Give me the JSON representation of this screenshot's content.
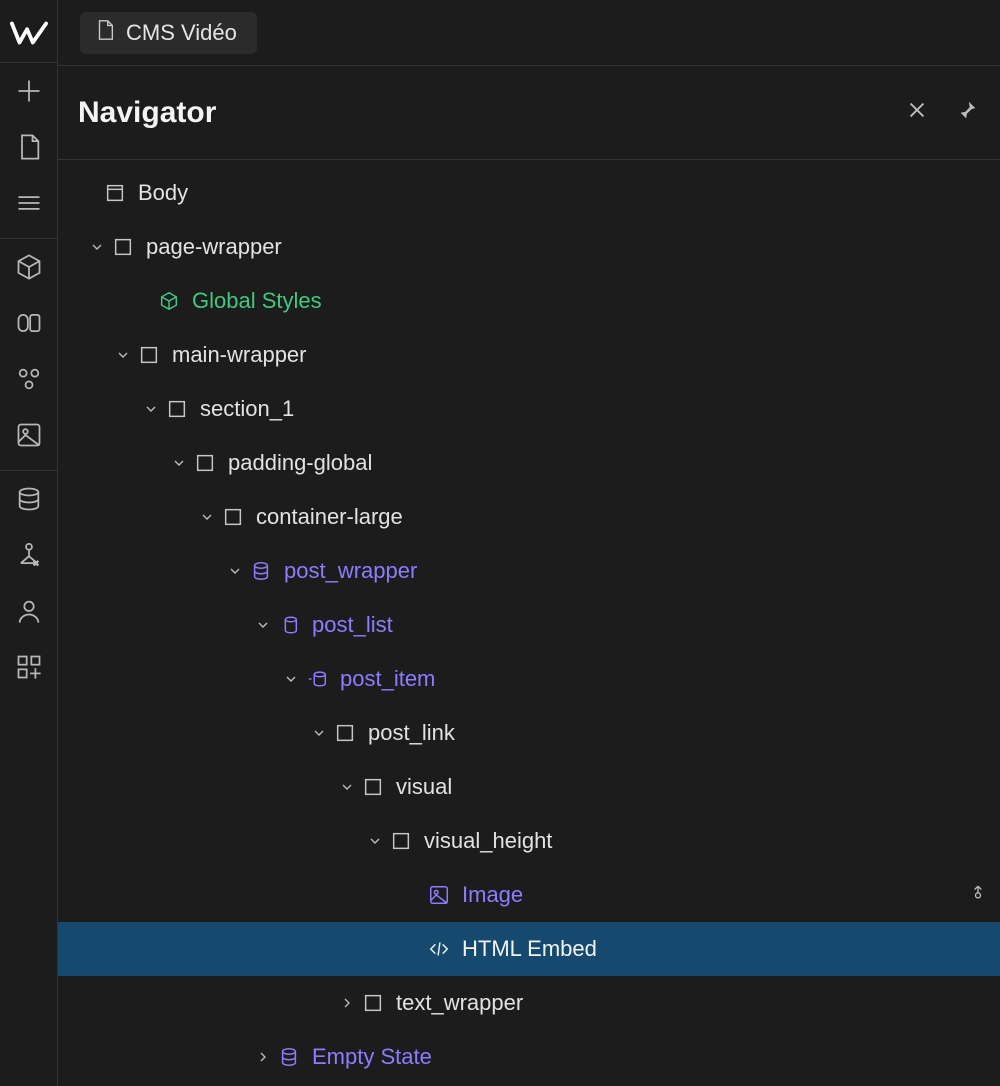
{
  "tab": {
    "label": "CMS Vidéo"
  },
  "panel": {
    "title": "Navigator"
  },
  "tree": {
    "body": "Body",
    "page_wrapper": "page-wrapper",
    "global_styles": "Global Styles",
    "main_wrapper": "main-wrapper",
    "section_1": "section_1",
    "padding_global": "padding-global",
    "container_large": "container-large",
    "post_wrapper": "post_wrapper",
    "post_list": "post_list",
    "post_item": "post_item",
    "post_link": "post_link",
    "visual": "visual",
    "visual_height": "visual_height",
    "image": "Image",
    "html_embed": "HTML Embed",
    "text_wrapper": "text_wrapper",
    "empty_state": "Empty State"
  }
}
